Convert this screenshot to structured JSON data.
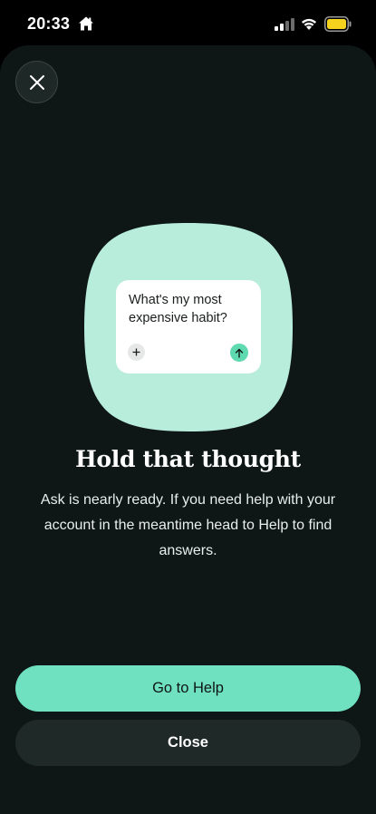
{
  "status_bar": {
    "time": "20:33",
    "icons": [
      "home-icon",
      "signal-icon",
      "wifi-icon",
      "battery-icon"
    ],
    "battery_color": "#f5d21e"
  },
  "sheet": {
    "close_icon": "close-icon",
    "illustration": {
      "prompt_text": "What's my most expensive habit?",
      "add_symbol": "+",
      "send_icon": "arrow-up-icon"
    },
    "title": "Hold that thought",
    "body": "Ask is nearly ready. If you need help with your account in the meantime head to Help to find answers.",
    "primary_button": "Go to Help",
    "secondary_button": "Close"
  },
  "colors": {
    "background": "#0e1716",
    "accent": "#6fe1c0",
    "blob": "#b8eddc",
    "secondary_button": "#1f2927"
  }
}
